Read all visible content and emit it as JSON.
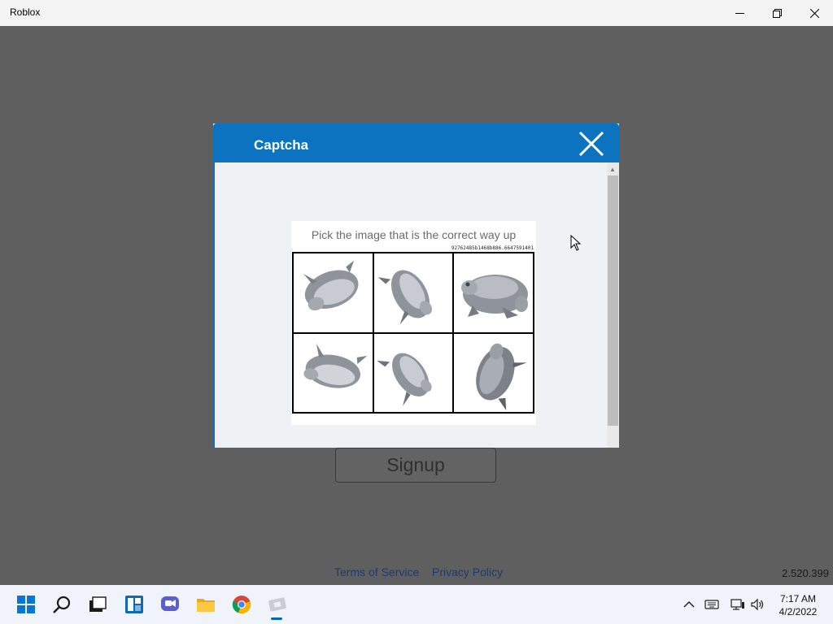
{
  "window": {
    "title": "Roblox"
  },
  "app": {
    "signup_label": "Signup",
    "terms_link": "Terms of Service",
    "privacy_link": "Privacy Policy",
    "version": "2.520.399"
  },
  "captcha": {
    "title": "Captcha",
    "prompt": "Pick the image that is the correct way up",
    "code": "92762485b1468b886.6647591401",
    "tiles": [
      {
        "icon": "rotated-frog-icon"
      },
      {
        "icon": "rotated-frog-icon"
      },
      {
        "icon": "upright-frog-icon"
      },
      {
        "icon": "rotated-frog-icon"
      },
      {
        "icon": "rotated-frog-icon"
      },
      {
        "icon": "rotated-frog-icon"
      }
    ]
  },
  "taskbar": {
    "time": "7:17 AM",
    "date": "4/2/2022"
  },
  "colors": {
    "modal_header": "#0b73bf",
    "app_background": "#5f5f5f"
  }
}
